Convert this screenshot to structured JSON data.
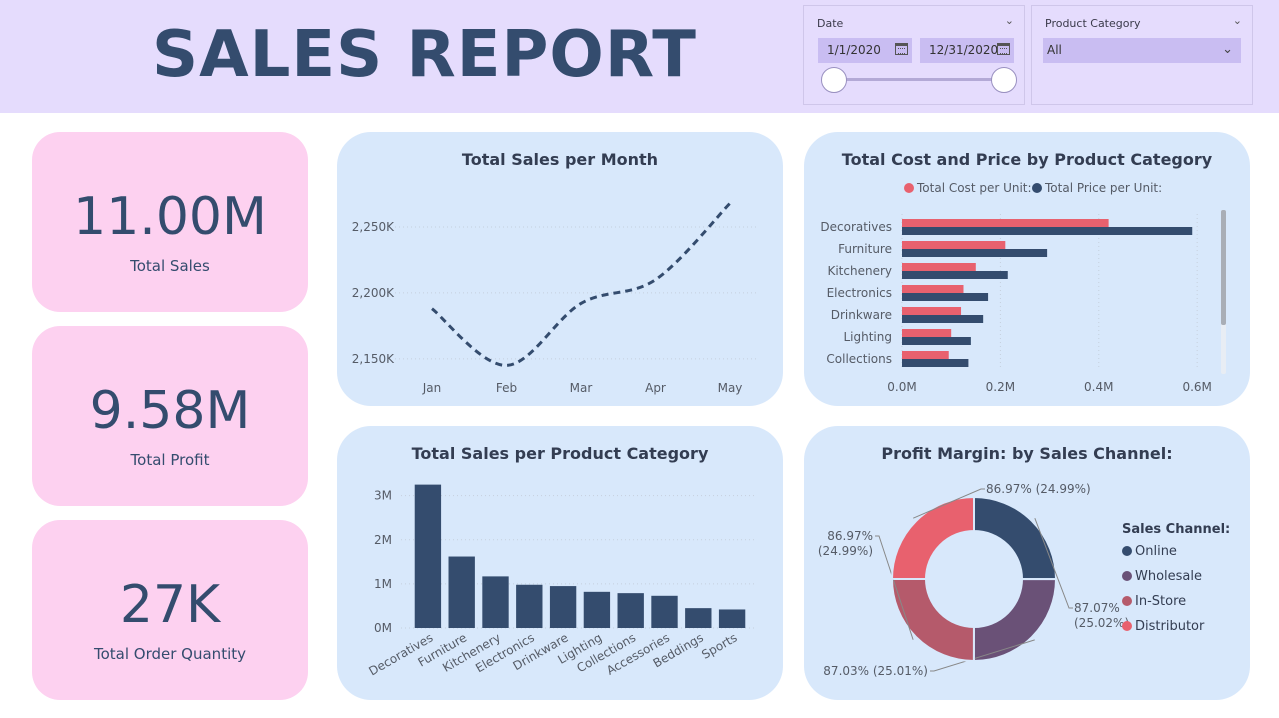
{
  "header": {
    "title": "SALES REPORT"
  },
  "date_slicer": {
    "label": "Date",
    "start": "1/1/2020",
    "end": "12/31/2020"
  },
  "category_slicer": {
    "label": "Product Category",
    "value": "All"
  },
  "kpis": [
    {
      "value": "11.00M",
      "label": "Total Sales"
    },
    {
      "value": "9.58M",
      "label": "Total Profit"
    },
    {
      "value": "27K",
      "label": "Total Order Quantity"
    }
  ],
  "colors": {
    "navy": "#344c6e",
    "coral": "#e8616e",
    "purple": "#6a5177",
    "rose": "#b55a6b",
    "card": "#d8e8fb",
    "kpi": "#fdd1f0",
    "header": "#e5dcfd"
  },
  "chart_data": [
    {
      "id": "sales-month",
      "type": "line",
      "title": "Total Sales per Month",
      "x": [
        "Jan",
        "Feb",
        "Mar",
        "Apr",
        "May"
      ],
      "values": [
        2188,
        2145,
        2192,
        2210,
        2268
      ],
      "yticks": [
        2150,
        2200,
        2250
      ],
      "ytick_labels": [
        "2,150K",
        "2,200K",
        "2,250K"
      ],
      "ylim": [
        2140,
        2275
      ],
      "style": "dashed"
    },
    {
      "id": "cost-price",
      "type": "bar",
      "orientation": "horizontal",
      "title": "Total Cost and Price by Product Category",
      "categories": [
        "Decoratives",
        "Furniture",
        "Kitchenery",
        "Electronics",
        "Drinkware",
        "Lighting",
        "Collections"
      ],
      "series": [
        {
          "name": "Total Cost per Unit:",
          "color": "#e8616e",
          "values": [
            0.42,
            0.21,
            0.15,
            0.125,
            0.12,
            0.1,
            0.095
          ]
        },
        {
          "name": "Total Price per Unit:",
          "color": "#344c6e",
          "values": [
            0.59,
            0.295,
            0.215,
            0.175,
            0.165,
            0.14,
            0.135
          ]
        }
      ],
      "xticks": [
        0,
        0.2,
        0.4,
        0.6
      ],
      "xtick_labels": [
        "0.0M",
        "0.2M",
        "0.4M",
        "0.6M"
      ],
      "xlim": [
        0,
        0.62
      ]
    },
    {
      "id": "sales-category",
      "type": "bar",
      "title": "Total Sales per Product Category",
      "categories": [
        "Decoratives",
        "Furniture",
        "Kitchenery",
        "Electronics",
        "Drinkware",
        "Lighting",
        "Collections",
        "Accessories",
        "Beddings",
        "Sports"
      ],
      "values": [
        3.25,
        1.62,
        1.17,
        0.98,
        0.95,
        0.82,
        0.79,
        0.73,
        0.45,
        0.42
      ],
      "yticks": [
        0,
        1,
        2,
        3
      ],
      "ytick_labels": [
        "0M",
        "1M",
        "2M",
        "3M"
      ],
      "ylim": [
        0,
        3.4
      ]
    },
    {
      "id": "profit-channel",
      "type": "pie",
      "title": "Profit Margin: by Sales Channel:",
      "legend_title": "Sales Channel:",
      "slices": [
        {
          "name": "Online",
          "value": 25.02,
          "color": "#344c6e",
          "label": "87.07% (25.02%)"
        },
        {
          "name": "Wholesale",
          "value": 25.01,
          "color": "#6a5177",
          "label": "87.03% (25.01%)"
        },
        {
          "name": "In-Store",
          "value": 24.99,
          "color": "#b55a6b",
          "label": "86.97% (24.99%)"
        },
        {
          "name": "Distributor",
          "value": 24.99,
          "color": "#e8616e",
          "label": "86.97% (24.99%)"
        }
      ]
    }
  ]
}
